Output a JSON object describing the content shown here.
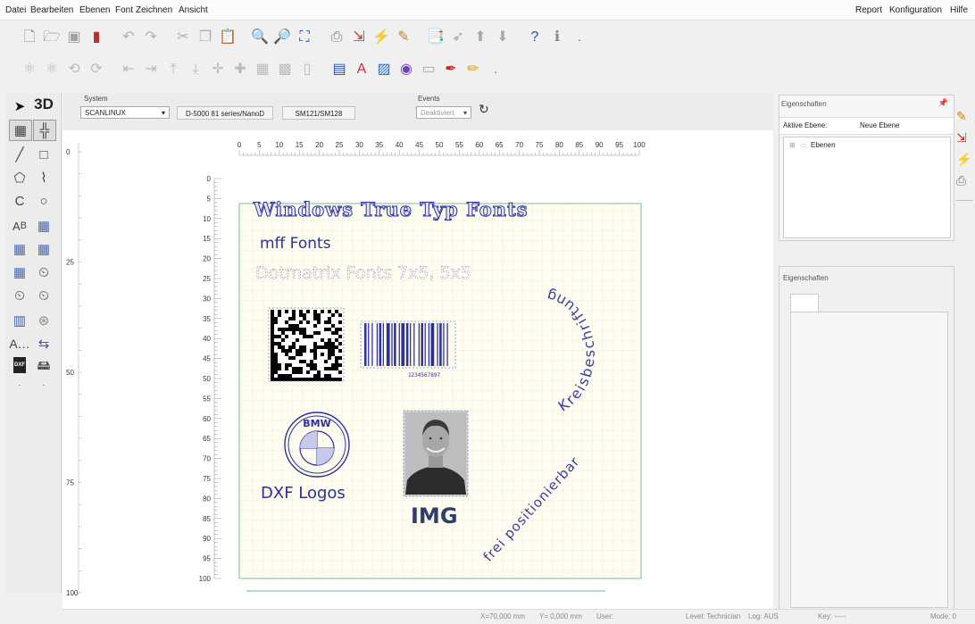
{
  "menu": {
    "left": [
      "Datei",
      "Bearbeiten",
      "Ebenen",
      "Font",
      "Zeichnen",
      "Ansicht"
    ],
    "right": [
      "Report",
      "Konfiguration",
      "Hilfe"
    ]
  },
  "system_bar": {
    "system_label": "System",
    "system_value": "SCANLINUX",
    "device": "D-5000 81 series/NanoD",
    "board": "SM121/SM128",
    "events_label": "Events",
    "events_value": "Deaktiviert"
  },
  "left_tools": {
    "view_3d": "3D",
    "dxf_badge": "DXF"
  },
  "rulers": {
    "top_ticks": [
      0,
      5,
      10,
      15,
      20,
      25,
      30,
      35,
      40,
      45,
      50,
      55,
      60,
      65,
      70,
      75,
      80,
      85,
      90,
      95,
      100
    ],
    "left_ticks": [
      0,
      5,
      10,
      15,
      20,
      25,
      30,
      35,
      40,
      45,
      50,
      55,
      60,
      65,
      70,
      75,
      80,
      85,
      90,
      95,
      100
    ],
    "outer_left": [
      0,
      25,
      50,
      75,
      100
    ]
  },
  "layout_content": {
    "heading_ttf": "Windows True Typ Fonts",
    "heading_mff": "mff Fonts",
    "heading_dotmatrix": "Dotmatrix Fonts 7x5, 5x5",
    "barcode_number": "1234567897",
    "circular_text": "Kreisbeschriftung",
    "logo_text": "BMW",
    "logo_caption": "DXF Logos",
    "image_label": "IMG",
    "free_text": "frei positionierbar"
  },
  "properties_top": {
    "title": "Eigenschaften",
    "active_layer_label": "Aktive Ebene:",
    "new_layer_button": "Neue Ebene",
    "tree_root": "Ebenen"
  },
  "properties_bottom": {
    "title": "Eigenschaften"
  },
  "status": {
    "x": "X=70,000 mm",
    "y": "Y= 0,000 mm",
    "user": "User:",
    "level": "Level: Technician",
    "log": "Log: AUS",
    "key": "Key: -----",
    "mode": "Mode: 0"
  },
  "colors": {
    "accent_blue": "#2b2fa0",
    "grid_bg": "#fffdf0",
    "frame_green": "#8cc8a0"
  }
}
